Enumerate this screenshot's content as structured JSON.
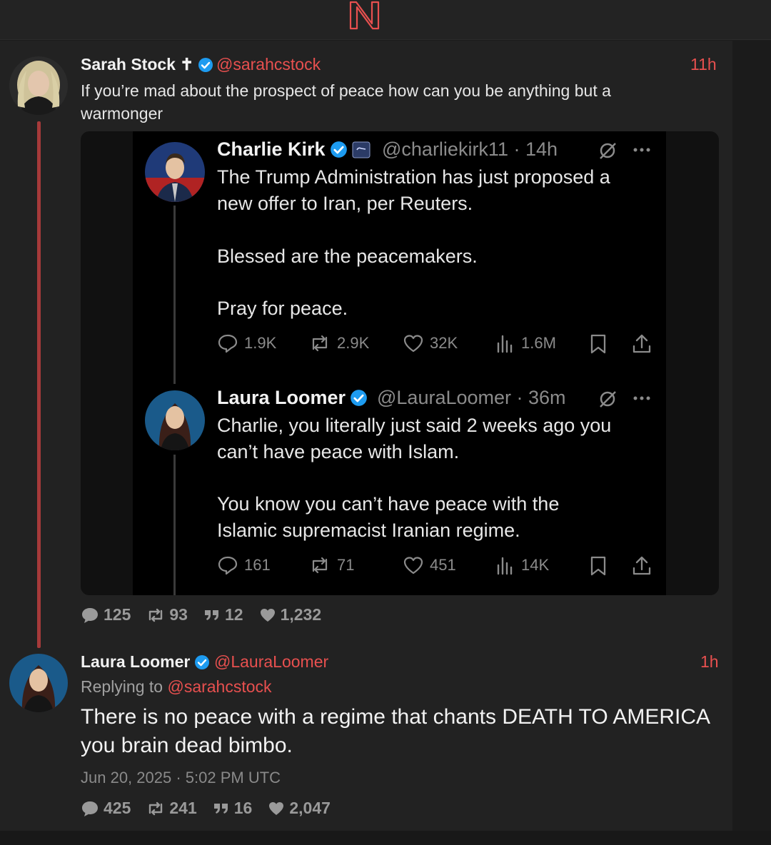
{
  "brand": {
    "logo_letter": "N",
    "accent": "#e8504f"
  },
  "post": {
    "author_name": "Sarah Stock",
    "author_emblem": "✝",
    "handle": "@sarahcstock",
    "time": "11h",
    "text": "If you’re mad about the prospect of peace how can you be anything but a warmonger",
    "stats": {
      "replies": "125",
      "reposts": "93",
      "quotes": "12",
      "likes": "1,232"
    },
    "embed": {
      "tweet1": {
        "name": "Charlie Kirk",
        "handle": "@charliekirk11",
        "meta": "· 14h",
        "lines": [
          "The Trump Administration has just proposed a",
          "new offer to Iran, per Reuters."
        ],
        "line2": "Blessed are the peacemakers.",
        "line3": "Pray for peace.",
        "actions": {
          "replies": "1.9K",
          "reposts": "2.9K",
          "likes": "32K",
          "views": "1.6M"
        }
      },
      "tweet2": {
        "name": "Laura Loomer",
        "handle": "@LauraLoomer",
        "meta": "· 36m",
        "lines": [
          "Charlie, you literally just said 2 weeks ago you",
          "can’t have peace with Islam."
        ],
        "lines2": [
          "You know you can’t have peace with the",
          "Islamic supremacist Iranian regime."
        ],
        "actions": {
          "replies": "161",
          "reposts": "71",
          "likes": "451",
          "views": "14K"
        }
      }
    }
  },
  "reply": {
    "author_name": "Laura Loomer",
    "handle": "@LauraLoomer",
    "time": "1h",
    "replying_prefix": "Replying to",
    "replying_to": "@sarahcstock",
    "text": "There is no peace with a regime that chants DEATH TO AMERICA you brain dead bimbo.",
    "date": "Jun 20, 2025 · 5:02 PM UTC",
    "stats": {
      "replies": "425",
      "reposts": "241",
      "quotes": "16",
      "likes": "2,047"
    }
  }
}
